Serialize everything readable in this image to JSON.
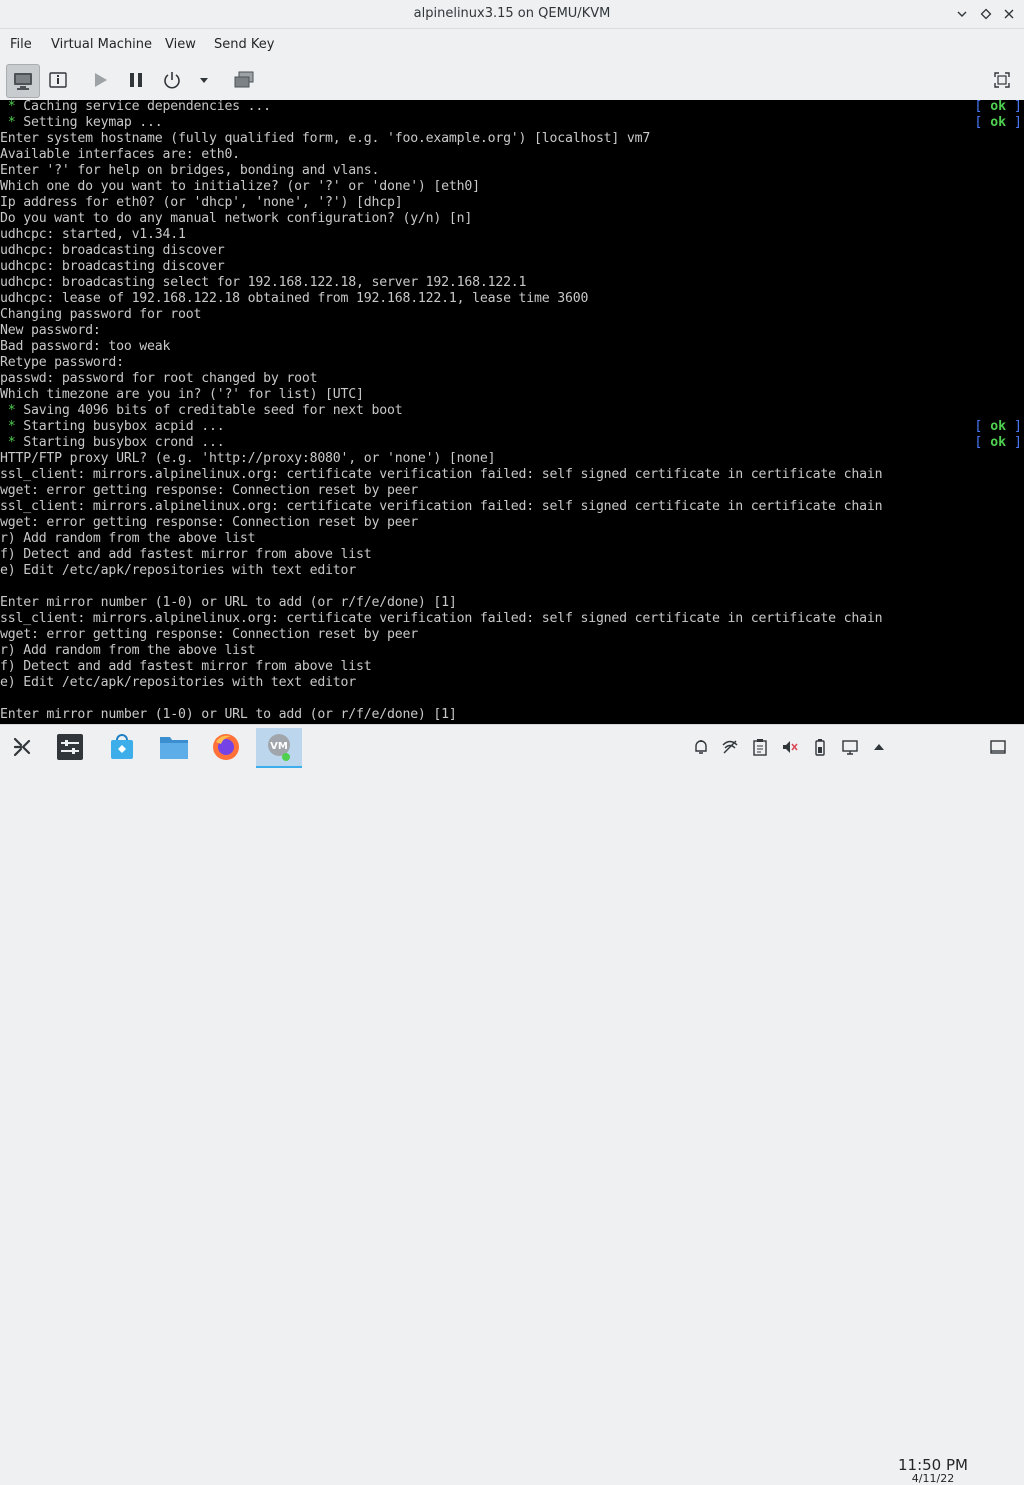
{
  "window": {
    "title": "alpinelinux3.15 on QEMU/KVM"
  },
  "menu": [
    "File",
    "Virtual Machine",
    "View",
    "Send Key"
  ],
  "toolbar": {
    "buttons": [
      "monitor-icon",
      "info-icon",
      "play-icon",
      "pause-icon",
      "power-icon",
      "dropdown-arrow-icon",
      "snapshots-icon",
      "fullscreen-icon"
    ]
  },
  "console": {
    "lines": [
      {
        "text": " * Caching service dependencies ...",
        "ok": true
      },
      {
        "text": " * Setting keymap ...",
        "ok": true
      },
      {
        "text": "Enter system hostname (fully qualified form, e.g. 'foo.example.org') [localhost] vm7",
        "ok": false
      },
      {
        "text": "Available interfaces are: eth0.",
        "ok": false
      },
      {
        "text": "Enter '?' for help on bridges, bonding and vlans.",
        "ok": false
      },
      {
        "text": "Which one do you want to initialize? (or '?' or 'done') [eth0]",
        "ok": false
      },
      {
        "text": "Ip address for eth0? (or 'dhcp', 'none', '?') [dhcp]",
        "ok": false
      },
      {
        "text": "Do you want to do any manual network configuration? (y/n) [n]",
        "ok": false
      },
      {
        "text": "udhcpc: started, v1.34.1",
        "ok": false
      },
      {
        "text": "udhcpc: broadcasting discover",
        "ok": false
      },
      {
        "text": "udhcpc: broadcasting discover",
        "ok": false
      },
      {
        "text": "udhcpc: broadcasting select for 192.168.122.18, server 192.168.122.1",
        "ok": false
      },
      {
        "text": "udhcpc: lease of 192.168.122.18 obtained from 192.168.122.1, lease time 3600",
        "ok": false
      },
      {
        "text": "Changing password for root",
        "ok": false
      },
      {
        "text": "New password:",
        "ok": false
      },
      {
        "text": "Bad password: too weak",
        "ok": false
      },
      {
        "text": "Retype password:",
        "ok": false
      },
      {
        "text": "passwd: password for root changed by root",
        "ok": false
      },
      {
        "text": "Which timezone are you in? ('?' for list) [UTC]",
        "ok": false
      },
      {
        "text": " * Saving 4096 bits of creditable seed for next boot",
        "ok": false
      },
      {
        "text": " * Starting busybox acpid ...",
        "ok": true
      },
      {
        "text": " * Starting busybox crond ...",
        "ok": true
      },
      {
        "text": "HTTP/FTP proxy URL? (e.g. 'http://proxy:8080', or 'none') [none]",
        "ok": false
      },
      {
        "text": "ssl_client: mirrors.alpinelinux.org: certificate verification failed: self signed certificate in certificate chain",
        "ok": false
      },
      {
        "text": "wget: error getting response: Connection reset by peer",
        "ok": false
      },
      {
        "text": "ssl_client: mirrors.alpinelinux.org: certificate verification failed: self signed certificate in certificate chain",
        "ok": false
      },
      {
        "text": "wget: error getting response: Connection reset by peer",
        "ok": false
      },
      {
        "text": "r) Add random from the above list",
        "ok": false
      },
      {
        "text": "f) Detect and add fastest mirror from above list",
        "ok": false
      },
      {
        "text": "e) Edit /etc/apk/repositories with text editor",
        "ok": false
      },
      {
        "text": "",
        "ok": false
      },
      {
        "text": "Enter mirror number (1-0) or URL to add (or r/f/e/done) [1]",
        "ok": false
      },
      {
        "text": "ssl_client: mirrors.alpinelinux.org: certificate verification failed: self signed certificate in certificate chain",
        "ok": false
      },
      {
        "text": "wget: error getting response: Connection reset by peer",
        "ok": false
      },
      {
        "text": "r) Add random from the above list",
        "ok": false
      },
      {
        "text": "f) Detect and add fastest mirror from above list",
        "ok": false
      },
      {
        "text": "e) Edit /etc/apk/repositories with text editor",
        "ok": false
      },
      {
        "text": "",
        "ok": false
      },
      {
        "text": "Enter mirror number (1-0) or URL to add (or r/f/e/done) [1]",
        "ok": false
      }
    ],
    "ok_left": "[ ",
    "ok_text": "ok",
    "ok_right": " ]"
  },
  "taskbar": {
    "apps": [
      "application-launcher-icon",
      "pager-icon",
      "discover-store-icon",
      "file-manager-icon",
      "firefox-icon",
      "virt-manager-icon"
    ],
    "tray": [
      "notifications-icon",
      "network-icon",
      "clipboard-icon",
      "volume-muted-icon",
      "battery-icon",
      "display-icon",
      "tray-expand-icon",
      "show-desktop-icon"
    ],
    "clock": {
      "time": "11:50 PM",
      "date": "4/11/22"
    }
  }
}
